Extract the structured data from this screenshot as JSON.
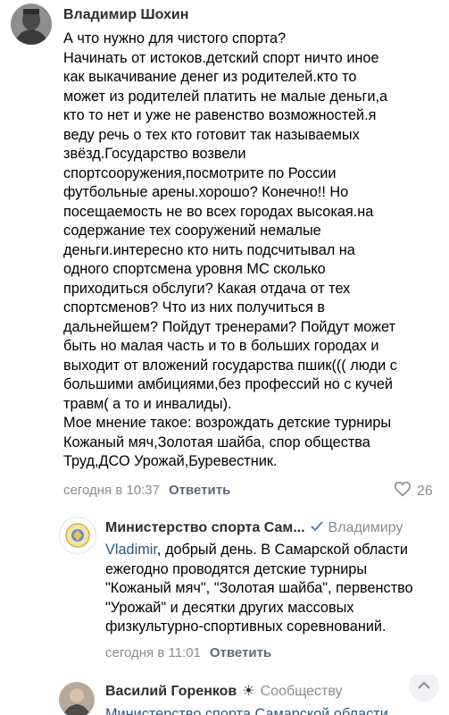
{
  "comments": [
    {
      "author": "Владимир Шохин",
      "text": "А что нужно для чистого спорта?\nНачинать от истоков.детский спорт ничто иное\nкак выкачивание денег из родителей.кто то\nможет из родителей платить не малые деньги,а\nкто то нет и уже не равенство возможностей.я\nведу речь о тех кто готовит так называемых\nзвёзд.Государство возвели\nспортсооружения,посмотрите по России\nфутбольные арены.хорошо? Конечно!! Но\nпосещаемость не во всех городах высокая.на\nсодержание тех сооружений немалые\nденьги.интересно кто нить подсчитывал на\nодного спортсмена уровня МС сколько\nприходиться обслуги? Какая отдача от тех\nспортсменов? Что из них получиться в\nдальнейшем? Пойдут тренерами? Пойдут может\nбыть но малая часть и то в больших городах и\nвыходит от вложений государства пшик((( люди с\nбольшими амбициями,без профессий но с кучей\nтравм( а то и инвалиды).\nМое мнение такое: возрождать детские турниры\nКожаный мяч,Золотая шайба, спор общества\nТруд,ДСО Урожай,Буревестник.",
      "time": "сегодня в 10:37",
      "reply_label": "Ответить",
      "likes": "26"
    },
    {
      "author": "Министерство спорта Сам...",
      "addressee": "Владимиру",
      "mention": "Vladimir",
      "text_after_mention": ", добрый день. В Самарской области\nежегодно проводятся детские турниры\n\"Кожаный мяч\", \"Золотая шайба\", первенство\n\"Урожай\" и десятки других массовых\nфизкультурно-спортивных соревнований.",
      "time": "сегодня в 11:01",
      "reply_label": "Ответить"
    },
    {
      "author": "Василий Горенков",
      "addressee": "Сообществу",
      "text": "Министерство спорта Самарской области"
    }
  ],
  "colors": {
    "link": "#2a5885",
    "muted": "#8a8d91",
    "reply": "#5c6a7a"
  },
  "icons": [
    "heart-icon",
    "verified-check-icon",
    "sun-emoji-icon",
    "chevron-up-icon"
  ]
}
